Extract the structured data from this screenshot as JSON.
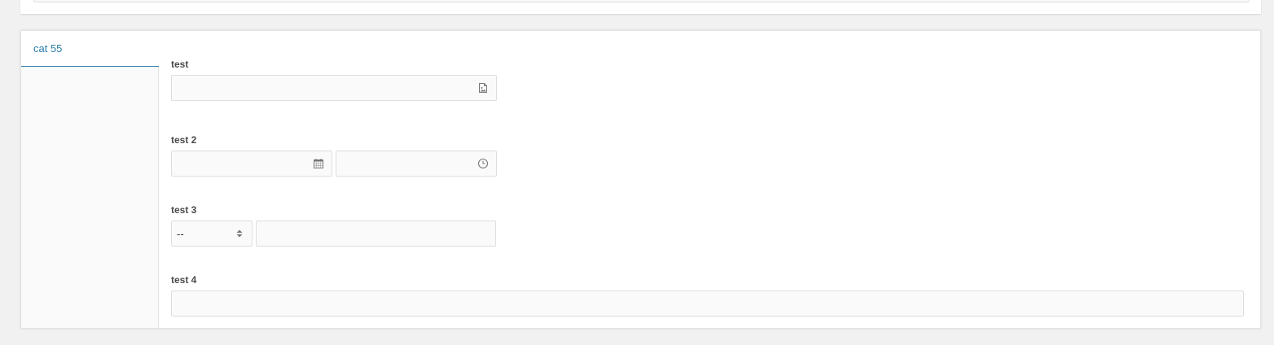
{
  "tabs": [
    {
      "label": "cat 55",
      "active": true
    }
  ],
  "fields": {
    "test1": {
      "label": "test",
      "value": "",
      "icon": "image-file-icon"
    },
    "test2": {
      "label": "test 2",
      "date_value": "",
      "time_value": "",
      "date_icon": "calendar-icon",
      "time_icon": "clock-icon"
    },
    "test3": {
      "label": "test 3",
      "select_value": "--",
      "text_value": "",
      "select_icon": "sort-arrows-icon"
    },
    "test4": {
      "label": "test 4",
      "value": ""
    }
  },
  "colors": {
    "accent": "#2a7dab",
    "background": "#f1f1f1",
    "panel": "#ffffff",
    "input_bg": "#fafafa",
    "input_border": "#dedede"
  }
}
